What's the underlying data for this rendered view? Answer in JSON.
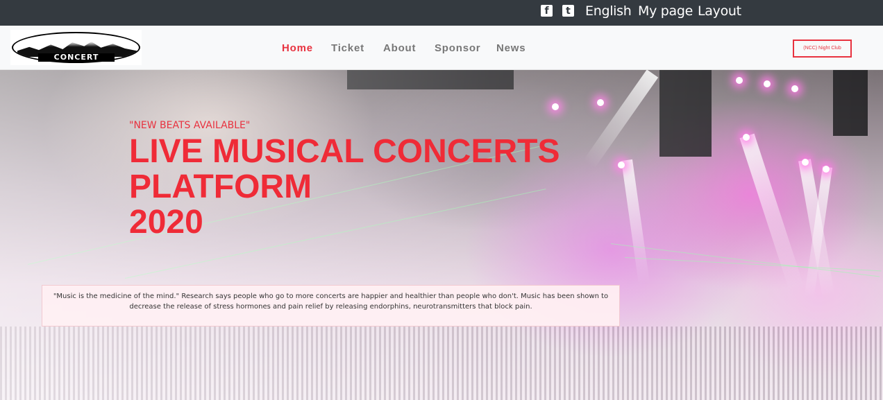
{
  "topbar": {
    "icons": [
      "facebook-square-icon",
      "twitter-square-icon"
    ],
    "links": [
      "English",
      "My page",
      "Layout"
    ]
  },
  "logo": {
    "text": "CONCERT"
  },
  "nav": {
    "items": [
      {
        "label": "Home",
        "active": true
      },
      {
        "label": "Ticket",
        "active": false
      },
      {
        "label": "About",
        "active": false
      },
      {
        "label": "Sponsor",
        "active": false
      },
      {
        "label": "News",
        "active": false
      }
    ],
    "cta_label": "(NCC) Night Club"
  },
  "hero": {
    "tagline": "\"NEW BEATS AVAILABLE\"",
    "headline_line1": "LIVE MUSICAL CONCERTS",
    "headline_line2": "PLATFORM",
    "headline_line3": "2020",
    "quote": "\"Music is the medicine of the mind.\" Research says people who go to more concerts are happier and healthier than people who don't. Music has been shown to decrease the release of stress hormones and pain relief by releasing endorphins, neurotransmitters that block pain."
  },
  "colors": {
    "accent": "#e8323f",
    "topbar_bg": "#343a40",
    "navbar_bg": "#f8f9fa"
  }
}
